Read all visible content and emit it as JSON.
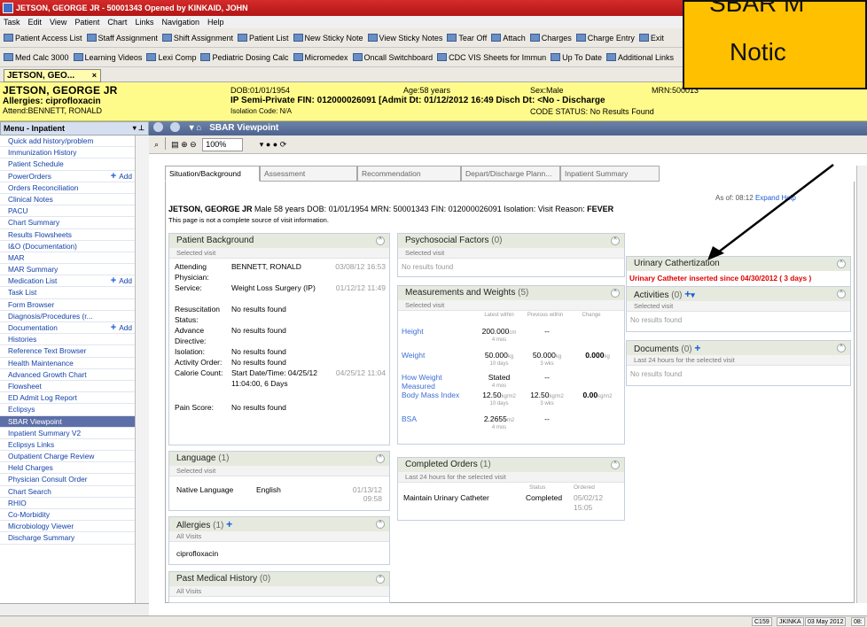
{
  "window": {
    "title": "JETSON, GEORGE JR - 50001343 Opened by KINKAID, JOHN"
  },
  "menubar": [
    "Task",
    "Edit",
    "View",
    "Patient",
    "Chart",
    "Links",
    "Navigation",
    "Help"
  ],
  "toolbar1": [
    "Patient Access List",
    "Staff Assignment",
    "Shift Assignment",
    "Patient List",
    "New Sticky Note",
    "View Sticky Notes",
    "Tear Off",
    "Attach",
    "Charges",
    "Charge Entry",
    "Exit"
  ],
  "toolbar2": [
    "Med Calc 3000",
    "Learning Videos",
    "Lexi Comp",
    "Pediatric Dosing Calc",
    "Micromedex",
    "Oncall Switchboard",
    "CDC VIS Sheets for Immun",
    "Up To Date",
    "Additional Links"
  ],
  "patient_tab": {
    "label": "JETSON, GEO...",
    "close": "×"
  },
  "banner": {
    "name": "JETSON, GEORGE JR",
    "allergies": "Allergies: ciprofloxacin",
    "attend": "Attend:BENNETT, RONALD",
    "dob": "DOB:01/01/1954",
    "age": "Age:58 years",
    "sex": "Sex:Male",
    "mrn": "MRN:500013",
    "encounter": "IP Semi-Private  FIN: 012000026091  [Admit Dt: 01/12/2012 16:49   Disch Dt: <No - Discharge",
    "isolation": "Isolation Code: N/A",
    "code_status": "CODE STATUS: No Results Found"
  },
  "menu": {
    "header": "Menu - Inpatient",
    "pin": "▾ ⊥",
    "add_label": "Add",
    "items": [
      {
        "label": "Quick add history/problem"
      },
      {
        "label": "Immunization History"
      },
      {
        "label": "Patient Schedule"
      },
      {
        "label": "PowerOrders",
        "add": true
      },
      {
        "label": "Orders Reconciliation"
      },
      {
        "label": "Clinical Notes"
      },
      {
        "label": "PACU"
      },
      {
        "label": "Chart Summary"
      },
      {
        "label": "Results Flowsheets"
      },
      {
        "label": "I&O (Documentation)"
      },
      {
        "label": "MAR"
      },
      {
        "label": "MAR Summary"
      },
      {
        "label": "Medication List",
        "add": true
      },
      {
        "label": "Task List"
      },
      {
        "label": "Form Browser"
      },
      {
        "label": "Diagnosis/Procedures (r..."
      },
      {
        "label": "Documentation",
        "add": true
      },
      {
        "label": "Histories"
      },
      {
        "label": "Reference Text Browser"
      },
      {
        "label": "Health Maintenance"
      },
      {
        "label": "Advanced Growth Chart"
      },
      {
        "label": "Flowsheet"
      },
      {
        "label": "ED Admit Log Report"
      },
      {
        "label": "Eclipsys"
      },
      {
        "label": "SBAR Viewpoint",
        "selected": true
      },
      {
        "label": "Inpatient Summary V2"
      },
      {
        "label": "Eclipsys Links"
      },
      {
        "label": "Outpatient Charge Review"
      },
      {
        "label": "Held Charges"
      },
      {
        "label": "Physician Consult Order"
      },
      {
        "label": "Chart Search"
      },
      {
        "label": "RHIO"
      },
      {
        "label": "Co-Morbidity"
      },
      {
        "label": "Microbiology Viewer"
      },
      {
        "label": "Discharge Summary"
      }
    ]
  },
  "sbar": {
    "title": "SBAR Viewpoint",
    "zoom": "100%",
    "tabs": [
      "Situation/Background",
      "Assessment",
      "Recommendation",
      "Depart/Discharge Plann...",
      "Inpatient Summary"
    ],
    "as_of": "As of: 08:12",
    "expand": "Expand",
    "help": "Help",
    "patient_line": {
      "name": "JETSON, GEORGE JR",
      "details": "Male   58 years   DOB: 01/01/1954   MRN: 50001343   FIN: 012000026091   Isolation:   Visit Reason:",
      "reason": "FEVER"
    },
    "disclaimer": "This page is not a complete source of visit information."
  },
  "panels": {
    "background": {
      "title": "Patient Background",
      "sub": "Selected visit",
      "rows": [
        {
          "label": "Attending Physician:",
          "value": "BENNETT, RONALD",
          "date": "03/08/12 16:53"
        },
        {
          "label": "Service:",
          "value": "Weight Loss Surgery (IP)",
          "date": "01/12/12 11:49"
        },
        {
          "label": "Resuscitation Status:",
          "value": "No results found",
          "date": ""
        },
        {
          "label": "Advance Directive:",
          "value": "No results found",
          "date": ""
        },
        {
          "label": "Isolation:",
          "value": "No results found",
          "date": ""
        },
        {
          "label": "Activity Order:",
          "value": "No results found",
          "date": ""
        },
        {
          "label": "Calorie Count:",
          "value": "Start Date/Time: 04/25/12 11:04:00, 6 Days",
          "date": "04/25/12 11:04"
        },
        {
          "label": "Pain Score:",
          "value": "No results found",
          "date": ""
        }
      ]
    },
    "language": {
      "title": "Language",
      "count": "(1)",
      "sub": "Selected visit",
      "label": "Native Language",
      "value": "English",
      "date": "01/13/12 09:58"
    },
    "allergies": {
      "title": "Allergies",
      "count": "(1)",
      "sub": "All Visits",
      "item": "ciprofloxacin"
    },
    "pmh": {
      "title": "Past Medical History",
      "count": "(0)",
      "sub": "All Visits"
    },
    "psychosocial": {
      "title": "Psychosocial Factors",
      "count": "(0)",
      "sub": "Selected visit",
      "empty": "No results found"
    },
    "measurements": {
      "title": "Measurements and Weights",
      "count": "(5)",
      "sub": "Selected visit",
      "headers": [
        "Latest within",
        "Previous within",
        "Change"
      ],
      "rows": [
        {
          "name": "Height",
          "latest": "200.000",
          "lunit": "cm",
          "latest_ago": "4 mos",
          "prev": "--",
          "prev_unit": "",
          "prev_ago": "",
          "change": "",
          "cunit": ""
        },
        {
          "name": "Weight",
          "latest": "50.000",
          "lunit": "kg",
          "latest_ago": "10 days",
          "prev": "50.000",
          "prev_unit": "kg",
          "prev_ago": "3 wks",
          "change": "0.000",
          "cunit": "kg"
        },
        {
          "name": "How Weight Measured",
          "latest": "Stated",
          "lunit": "",
          "latest_ago": "4 mos",
          "prev": "--",
          "prev_unit": "",
          "prev_ago": "",
          "change": "",
          "cunit": ""
        },
        {
          "name": "Body Mass Index",
          "latest": "12.50",
          "lunit": "kg/m2",
          "latest_ago": "10 days",
          "prev": "12.50",
          "prev_unit": "kg/m2",
          "prev_ago": "3 wks",
          "change": "0.00",
          "cunit": "kg/m2"
        },
        {
          "name": "BSA",
          "latest": "2.2655",
          "lunit": "m2",
          "latest_ago": "4 mos",
          "prev": "--",
          "prev_unit": "",
          "prev_ago": "",
          "change": "",
          "cunit": ""
        }
      ]
    },
    "completed": {
      "title": "Completed Orders",
      "count": "(1)",
      "sub": "Last 24 hours for the selected visit",
      "h_status": "Status",
      "h_ordered": "Ordered",
      "order": "Maintain Urinary Catheter",
      "status": "Completed",
      "date": "05/02/12 15:05"
    },
    "urinary": {
      "title": "Urinary Cathertization",
      "text": "Urinary Catheter inserted since 04/30/2012 ( 3 days )"
    },
    "activities": {
      "title": "Activities",
      "count": "(0)",
      "sub": "Selected visit",
      "empty": "No results found"
    },
    "documents": {
      "title": "Documents",
      "count": "(0)",
      "sub": "Last 24 hours for the selected visit",
      "empty": "No results found"
    }
  },
  "callout": {
    "line1": "SBAR M",
    "line2": "Notic"
  },
  "statusbar": [
    "C159",
    "JKINKA",
    "03 May 2012",
    "08:"
  ]
}
